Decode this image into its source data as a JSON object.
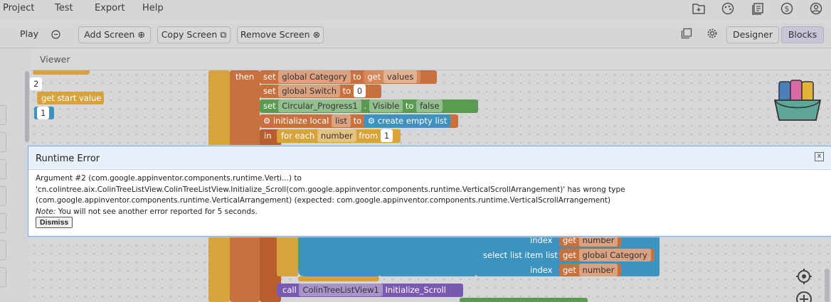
{
  "menu": {
    "items": [
      "Project",
      "Test",
      "Export",
      "Help"
    ]
  },
  "toolbar": {
    "play": "Play",
    "add_screen": "Add Screen",
    "copy_screen": "Copy Screen",
    "remove_screen": "Remove Screen",
    "designer": "Designer",
    "blocks": "Blocks"
  },
  "viewer": {
    "title": "Viewer"
  },
  "blocks": {
    "then": "then",
    "set": "set",
    "to": "to",
    "get": "get",
    "in": "in",
    "global_category": "global Category",
    "values": "values",
    "global_switch": "global Switch",
    "zero": "0",
    "circular_progress": "Circular_Progress1",
    "visible": "Visible",
    "false_val": "false",
    "initialize_local": "initialize local",
    "list": "list",
    "create_empty_list": "create empty list",
    "for_each": "for each",
    "number": "number",
    "from": "from",
    "one": "1",
    "two": "2",
    "get_start_value": "get start value",
    "index": "index",
    "select_list_item": "select list item",
    "list_label": "list",
    "call": "call",
    "colin_tree": "ColinTreeListView1",
    "initialize_scroll": "Initialize_Scroll"
  },
  "dialog": {
    "title": "Runtime Error",
    "message": "Argument #2 (com.google.appinventor.components.runtime.Verti...) to 'cn.colintree.aix.ColinTreeListView.ColinTreeListView.Initialize_Scroll(com.google.appinventor.components.runtime.VerticalScrollArrangement)' has wrong type (com.google.appinventor.components.runtime.VerticalArrangement) (expected: com.google.appinventor.components.runtime.VerticalScrollArrangement)",
    "note_label": "Note:",
    "note_text": "You will not see another error reported for 5 seconds.",
    "dismiss": "Dismiss",
    "close_symbol": "x"
  },
  "icons": [
    "folder-plus-icon",
    "palette-icon",
    "library-icon",
    "dollar-icon",
    "account-icon",
    "gallery-icon",
    "gear-icon",
    "target-icon",
    "zoom-in-icon",
    "backpack-icon"
  ]
}
